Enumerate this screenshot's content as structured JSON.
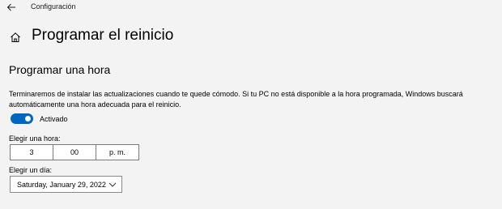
{
  "window": {
    "app_title": "Configuración",
    "back_icon": "back-arrow-icon"
  },
  "header": {
    "home_icon": "home-icon",
    "title": "Programar el reinicio"
  },
  "section": {
    "title": "Programar una hora",
    "description": "Terminaremos de instalar las actualizaciones cuando te quede cómodo. Si tu PC no está disponible a la hora programada, Windows buscará automáticamente una hora adecuada para el reinicio."
  },
  "toggle": {
    "state": true,
    "label": "Activado",
    "accent_color": "#0067c0"
  },
  "time": {
    "label": "Elegir una hora:",
    "hour": "3",
    "minute": "00",
    "ampm": "p. m."
  },
  "day": {
    "label": "Elegir un día:",
    "value": "Saturday, January 29, 2022",
    "chevron_icon": "chevron-down-icon"
  }
}
